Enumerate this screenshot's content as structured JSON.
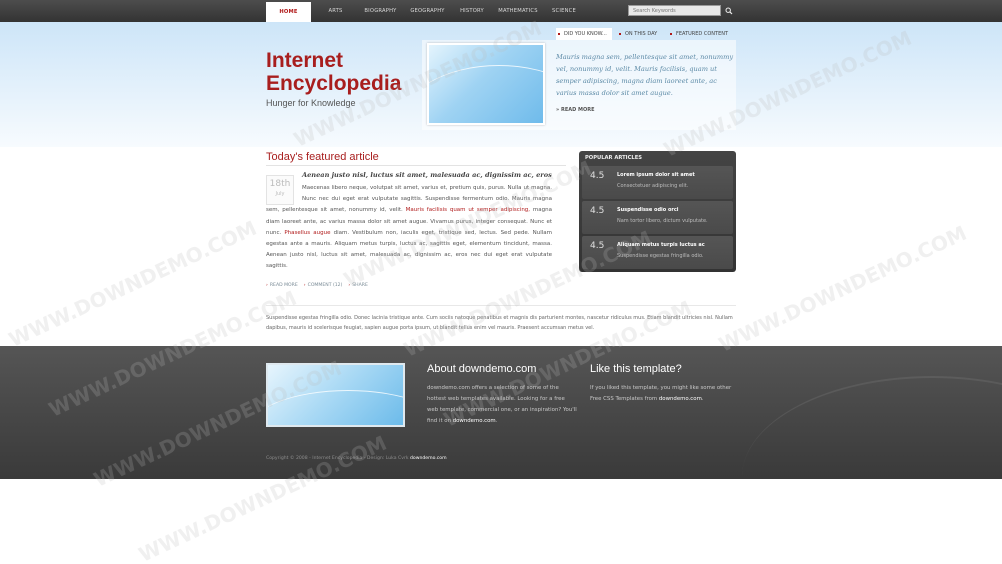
{
  "nav": {
    "items": [
      {
        "label": "HOME"
      },
      {
        "label": "ARTS"
      },
      {
        "label": "BIOGRAPHY"
      },
      {
        "label": "GEOGRAPHY"
      },
      {
        "label": "HISTORY"
      },
      {
        "label": "MATHEMATICS"
      },
      {
        "label": "SCIENCE"
      }
    ],
    "active": "HOME"
  },
  "search": {
    "placeholder": "Search Keywords"
  },
  "site": {
    "title": "Internet Encyclopedia",
    "tagline": "Hunger for Knowledge"
  },
  "featured_tabs": [
    "DID YOU KNOW...",
    "ON THIS DAY",
    "FEATURED CONTENT"
  ],
  "featured": {
    "text": "Mauris magna sem, pellentesque sit amet, nonummy vel, nonummy id, velit. Mauris facilisis, quam ut semper adipiscing, magna diam laoreet ante, ac varius massa dolor sit amet augue.",
    "more": "READ MORE"
  },
  "article": {
    "heading": "Today's featured article",
    "lead": "Aenean justo nisl, luctus sit amet, malesuada ac, dignissim ac, eros",
    "date_day": "18th",
    "date_month": "July",
    "body_1": "Maecenas libero neque, volutpat sit amet, varius et, pretium quis, purus. Nulla ut magna. Nunc nec dui eget erat vulputate sagittis. Suspendisse fermentum odio. Mauris magna sem, pellentesque sit amet, nonummy id, velit. ",
    "body_link_1": "Mauris facilisis quam ut semper adipiscing,",
    "body_2": " magna diam laoreet ante, ac varius massa dolor sit amet augue. Vivamus purus, integer consequat. Nunc et nunc. ",
    "body_link_2": "Phasellus augue",
    "body_3": " diam. Vestibulum non, iaculis eget, tristique sed, lectus. Sed pede. Nullam egestas ante a mauris. Aliquam metus turpis, luctus ac, sagittis eget, elementum tincidunt, massa. Aenean justo nisl, luctus sit amet, malesuada ac, dignissim ac, eros nec dui eget erat vulputate sagittis.",
    "links": [
      "READ MORE",
      "COMMENT (12)",
      "SHARE"
    ]
  },
  "popular": {
    "title": "POPULAR ARTICLES",
    "items": [
      {
        "score": "4.5",
        "title": "Lorem ipsum dolor sit amet",
        "desc": "Consectetuer adipiscing elit."
      },
      {
        "score": "4.5",
        "title": "Suspendisse odio orci",
        "desc": "Nam tortor libero, dictum vulputate."
      },
      {
        "score": "4.5",
        "title": "Aliquam metus turpis luctus ac",
        "desc": "Suspendisse egestas fringilla odio."
      }
    ]
  },
  "bottom_paragraph": "Suspendisse egestas fringilla odio. Donec lacinia tristique ante. Cum sociis natoque penatibus et magnis dis parturient montes, nascetur ridiculus mus. Etiam blandit ultricies nisl. Nullam dapibus, mauris id scelerisque feugiat, sapien augue porta ipsum, ut blandit tellus enim vel mauris. Praesent accumsan metus vel.",
  "footer": {
    "about_title": "About downdemo.com",
    "about_text_1": "downdemo.com offers a selection of some of the hottest web templates available. Looking for a free web template, commercial one, or an inspiration? You'll find it on ",
    "about_link": "downdemo.com",
    "about_text_2": ".",
    "like_title": "Like this template?",
    "like_text": "If you liked this template, you might like some other Free CSS Templates from ",
    "like_link": "downdemo.com",
    "like_text_2": ".",
    "copyright_text": "Copyright © 2008 - Internet Encyclopedia - Design: Luka Cvrk ",
    "copyright_link": "downdemo.com"
  },
  "watermark": "WWW.DOWNDEMO.COM"
}
